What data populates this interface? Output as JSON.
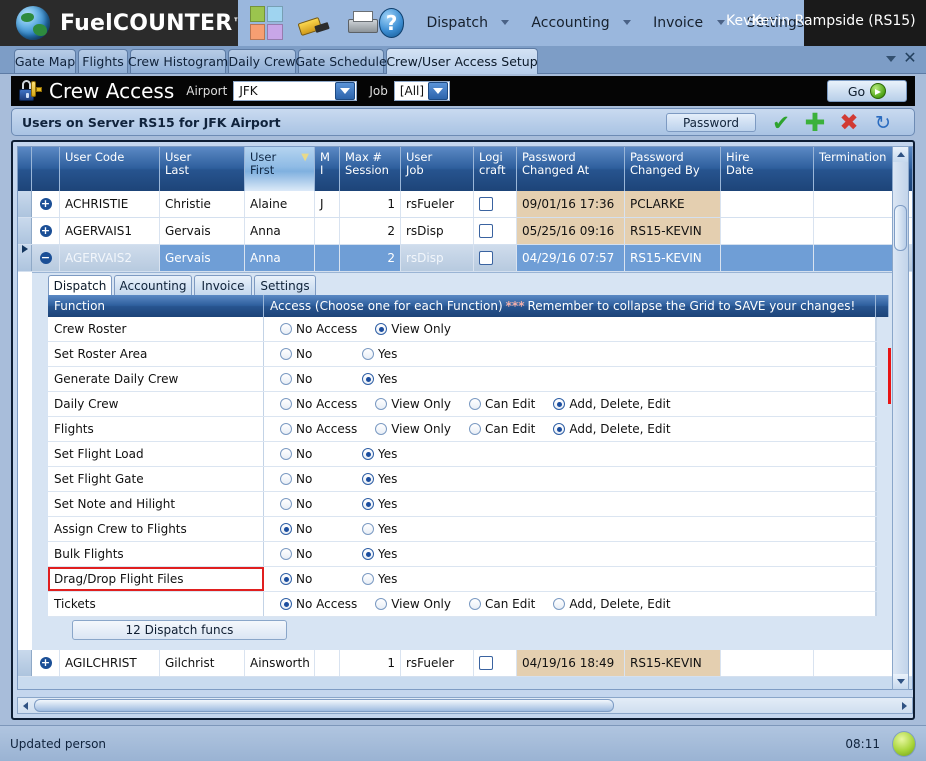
{
  "app": {
    "brand": "FuelCOUNTER",
    "brand_tm": "™",
    "toolbar_icons": [
      "quad-palette-icon",
      "drill-icon",
      "printer-icon",
      "help-icon"
    ],
    "help_glyph": "?",
    "menus": [
      {
        "label": "Dispatch",
        "has_caret": true
      },
      {
        "label": "Accounting",
        "has_caret": true
      },
      {
        "label": "Invoice",
        "has_caret": true
      },
      {
        "label": "Settings",
        "has_caret": false
      }
    ],
    "user_short": "Kevin",
    "user_full": "Kevin Rampside (RS15)"
  },
  "tabbar": {
    "tabs": [
      {
        "label": "Gate Map",
        "active": false
      },
      {
        "label": "Flights",
        "active": false
      },
      {
        "label": "Crew Histogram",
        "active": false
      },
      {
        "label": "Daily Crew",
        "active": false
      },
      {
        "label": "Gate Schedule",
        "active": false
      },
      {
        "label": "Crew/User Access Setup",
        "active": true
      }
    ],
    "close_glyph": "✕"
  },
  "page_header": {
    "title": "Crew Access",
    "airport_label": "Airport",
    "airport_value": "JFK",
    "job_label": "Job",
    "job_value": "[All]",
    "go_label": "Go"
  },
  "subheader": {
    "title": "Users on Server RS15 for JFK Airport",
    "password_label": "Password",
    "check_glyph": "✔",
    "plus_glyph": "✚",
    "cross_glyph": "✖",
    "refresh_glyph": "↻"
  },
  "grid": {
    "columns": [
      {
        "key": "code",
        "line1": "User Code",
        "line2": "",
        "filtered": false
      },
      {
        "key": "last",
        "line1": "User",
        "line2": "Last",
        "filtered": false
      },
      {
        "key": "first",
        "line1": "User",
        "line2": "First",
        "filtered": true
      },
      {
        "key": "mi",
        "line1": "M",
        "line2": "I",
        "filtered": false
      },
      {
        "key": "sess",
        "line1": "Max #",
        "line2": "Session",
        "filtered": false
      },
      {
        "key": "job",
        "line1": "User",
        "line2": "Job",
        "filtered": false
      },
      {
        "key": "logi",
        "line1": "Logi",
        "line2": "craft",
        "filtered": false
      },
      {
        "key": "pwat",
        "line1": "Password",
        "line2": "Changed At",
        "filtered": false
      },
      {
        "key": "pwby",
        "line1": "Password",
        "line2": "Changed By",
        "filtered": false
      },
      {
        "key": "hire",
        "line1": "Hire",
        "line2": "Date",
        "filtered": false
      },
      {
        "key": "term",
        "line1": "Termination",
        "line2": "",
        "filtered": false
      }
    ],
    "rows": [
      {
        "expander": "+",
        "selected": false,
        "row_marker": false,
        "code": "ACHRISTIE",
        "last": "Christie",
        "first": "Alaine",
        "mi": "J",
        "sess": "1",
        "job": "rsFueler",
        "logi_checked": false,
        "pwat": "09/01/16 17:36",
        "pwby": "PCLARKE",
        "hire": "",
        "term": ""
      },
      {
        "expander": "+",
        "selected": false,
        "row_marker": false,
        "code": "AGERVAIS1",
        "last": "Gervais",
        "first": "Anna",
        "mi": "",
        "sess": "2",
        "job": "rsDisp",
        "logi_checked": false,
        "pwat": "05/25/16 09:16",
        "pwby": "RS15-KEVIN",
        "hire": "",
        "term": ""
      },
      {
        "expander": "−",
        "selected": true,
        "row_marker": true,
        "code": "AGERVAIS2",
        "last": "Gervais",
        "first": "Anna",
        "mi": "",
        "sess": "2",
        "job": "rsDisp",
        "logi_checked": false,
        "pwat": "04/29/16 07:57",
        "pwby": "RS15-KEVIN",
        "hire": "",
        "term": ""
      }
    ],
    "bottom_row": {
      "expander": "+",
      "selected": false,
      "row_marker": false,
      "code": "AGILCHRIST",
      "last": "Gilchrist",
      "first": "Ainsworth",
      "mi": "",
      "sess": "1",
      "job": "rsFueler",
      "logi_checked": false,
      "pwat": "04/19/16 18:49",
      "pwby": "RS15-KEVIN",
      "hire": "",
      "term": ""
    }
  },
  "detail": {
    "tabs": [
      {
        "label": "Dispatch",
        "active": true
      },
      {
        "label": "Accounting",
        "active": false
      },
      {
        "label": "Invoice",
        "active": false
      },
      {
        "label": "Settings",
        "active": false
      }
    ],
    "func_header": "Function",
    "access_header_a": "Access (Choose one for each Function)",
    "access_header_stars": "***",
    "access_header_b": "Remember to collapse the Grid to SAVE your changes!",
    "functions": [
      {
        "name": "Crew Roster",
        "highlight": false,
        "options": [
          "No Access",
          "View Only"
        ],
        "selected": 1
      },
      {
        "name": "Set Roster Area",
        "highlight": false,
        "options": [
          "No",
          "Yes"
        ],
        "selected": -1
      },
      {
        "name": "Generate Daily Crew",
        "highlight": false,
        "options": [
          "No",
          "Yes"
        ],
        "selected": 1
      },
      {
        "name": "Daily Crew",
        "highlight": false,
        "options": [
          "No Access",
          "View Only",
          "Can Edit",
          "Add, Delete, Edit"
        ],
        "selected": 3
      },
      {
        "name": "Flights",
        "highlight": false,
        "options": [
          "No Access",
          "View Only",
          "Can Edit",
          "Add, Delete, Edit"
        ],
        "selected": 3
      },
      {
        "name": "Set Flight Load",
        "highlight": false,
        "options": [
          "No",
          "Yes"
        ],
        "selected": 1
      },
      {
        "name": "Set Flight Gate",
        "highlight": false,
        "options": [
          "No",
          "Yes"
        ],
        "selected": 1
      },
      {
        "name": "Set Note and Hilight",
        "highlight": false,
        "options": [
          "No",
          "Yes"
        ],
        "selected": 1
      },
      {
        "name": "Assign Crew to Flights",
        "highlight": false,
        "options": [
          "No",
          "Yes"
        ],
        "selected": 0
      },
      {
        "name": "Bulk Flights",
        "highlight": false,
        "options": [
          "No",
          "Yes"
        ],
        "selected": 1
      },
      {
        "name": "Drag/Drop Flight Files",
        "highlight": true,
        "options": [
          "No",
          "Yes"
        ],
        "selected": 0
      },
      {
        "name": "Tickets",
        "highlight": false,
        "options": [
          "No Access",
          "View Only",
          "Can Edit",
          "Add, Delete, Edit"
        ],
        "selected": 0
      }
    ],
    "func_count": "12 Dispatch funcs"
  },
  "statusbar": {
    "message": "Updated person",
    "time": "08:11"
  },
  "colors": {
    "accent_blue": "#1d4478",
    "header_black": "#050505",
    "highlight_red": "#e01f1f",
    "beige_cell": "#e4cfb0",
    "edit_blue": "#6f9ed6",
    "led_green": "#a8d53a"
  }
}
